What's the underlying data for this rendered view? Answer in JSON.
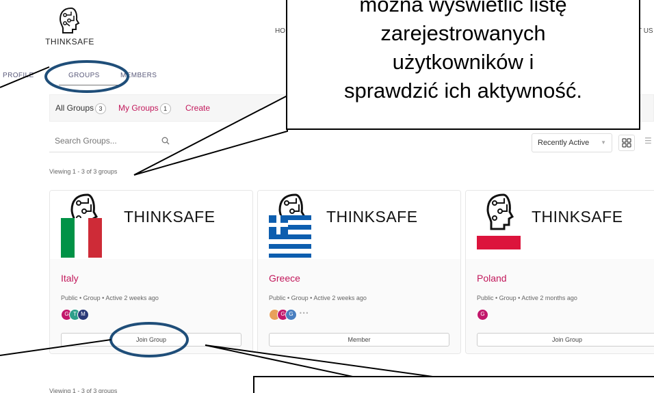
{
  "header": {
    "logo_text": "THINKSAFE",
    "nav_left_fragment": "HO",
    "nav_right_fragment": "T US"
  },
  "tabs": [
    {
      "label": "PROFILE"
    },
    {
      "label": "GROUPS"
    },
    {
      "label": "MEMBERS"
    }
  ],
  "subnav": {
    "all_groups": {
      "label": "All Groups",
      "count": "3"
    },
    "my_groups": {
      "label": "My Groups",
      "count": "1"
    },
    "create": {
      "label": "Create"
    }
  },
  "search": {
    "placeholder": "Search Groups..."
  },
  "sort": {
    "selected": "Recently Active"
  },
  "viewing_text": "Viewing 1 - 3 of 3 groups",
  "brand_text": "THINKSAFE",
  "groups": [
    {
      "name": "Italy",
      "meta": "Public • Group • Active 2 weeks ago",
      "avatars": [
        {
          "initial": "G",
          "color": "#c2186b"
        },
        {
          "initial": "T",
          "color": "#2e9f8a"
        },
        {
          "initial": "M",
          "color": "#2b3a78"
        }
      ],
      "button": "Join Group"
    },
    {
      "name": "Greece",
      "meta": "Public • Group • Active 2 weeks ago",
      "avatars": [
        {
          "initial": "",
          "color": "#e8a15a"
        },
        {
          "initial": "G",
          "color": "#c2186b"
        },
        {
          "initial": "G",
          "color": "#4a7fc0"
        }
      ],
      "more": "•••",
      "button": "Member"
    },
    {
      "name": "Poland",
      "meta": "Public • Group • Active 2 months ago",
      "avatars": [
        {
          "initial": "G",
          "color": "#c2186b"
        }
      ],
      "button": "Join Group"
    }
  ],
  "callout_top": {
    "lines": [
      "można wyświetlić listę",
      "zarejestrowanych",
      "użytkowników i",
      "sprawdzić ich aktywność."
    ]
  },
  "colors": {
    "accent": "#c2185b",
    "annotation_ring": "#1f4e79"
  }
}
